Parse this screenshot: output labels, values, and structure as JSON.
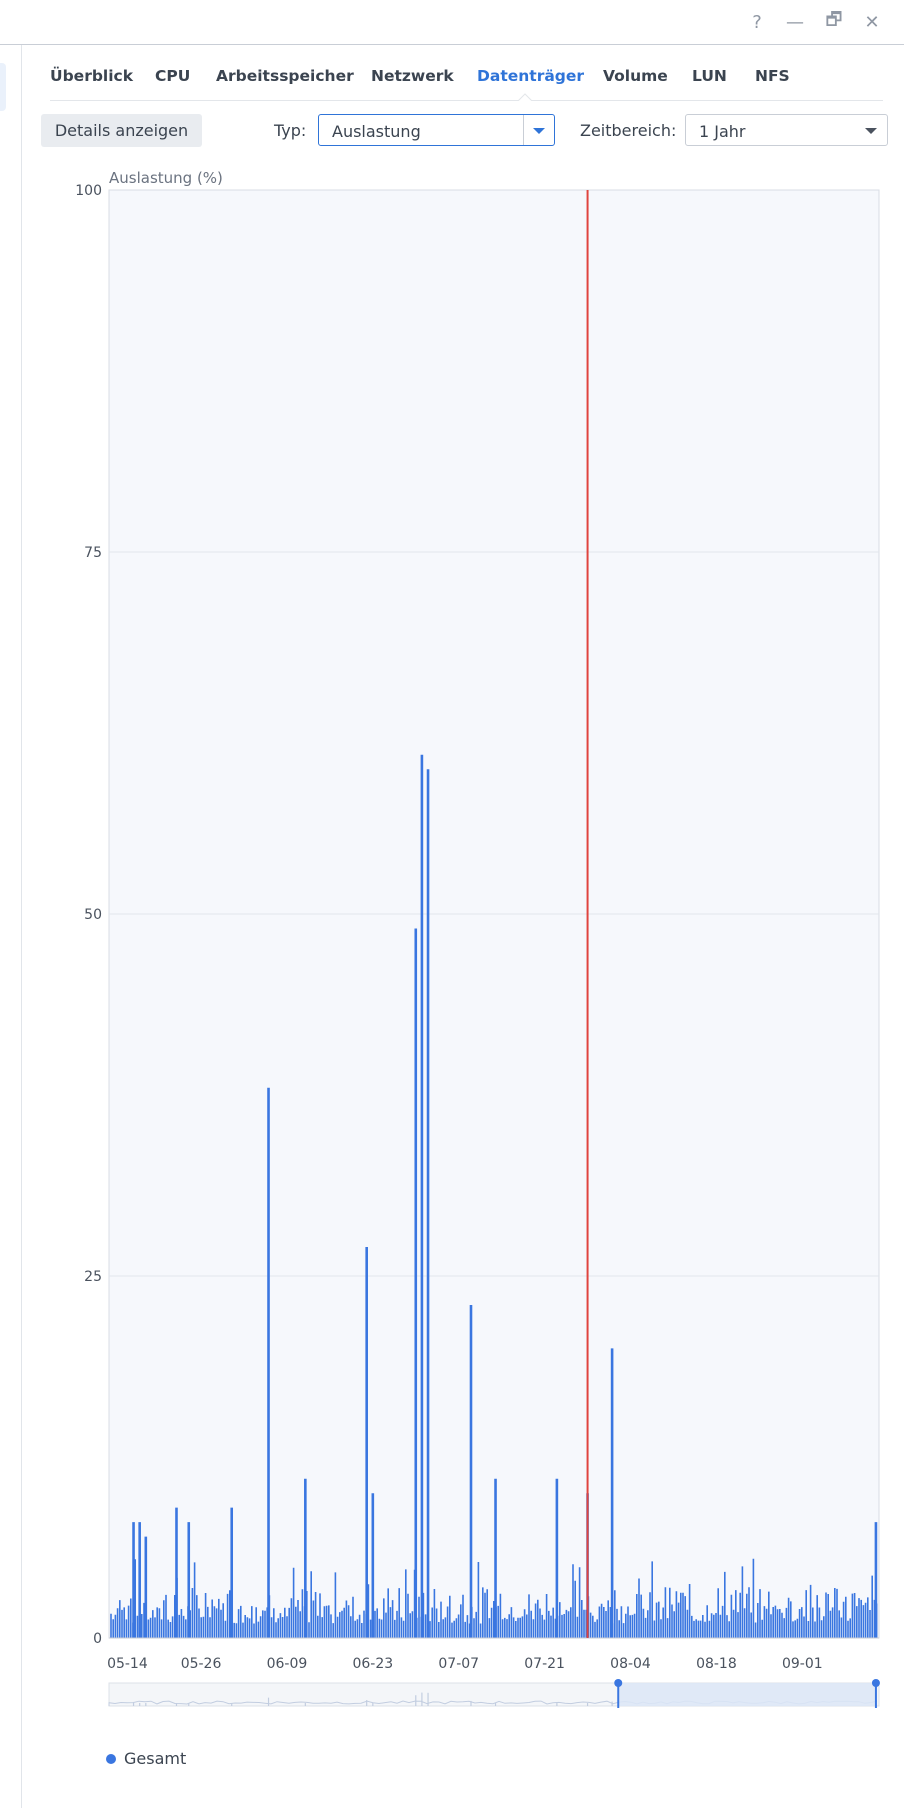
{
  "window": {
    "help_label": "?",
    "minimize_label": "—",
    "restore_label": "🗗",
    "close_label": "✕"
  },
  "tabs": [
    {
      "label": "Überblick"
    },
    {
      "label": "CPU"
    },
    {
      "label": "Arbeitsspeicher"
    },
    {
      "label": "Netzwerk"
    },
    {
      "label": "Datenträger",
      "active": true
    },
    {
      "label": "Volume"
    },
    {
      "label": "LUN"
    },
    {
      "label": "NFS"
    }
  ],
  "toolbar": {
    "details_label": "Details anzeigen",
    "type_label": "Typ:",
    "type_value": "Auslastung",
    "range_label": "Zeitbereich:",
    "range_value": "1 Jahr"
  },
  "colors": {
    "accent": "#2f74d8",
    "series": "#3a76e0",
    "cursor": "#e0443e",
    "plot_bg": "#f6f8fc"
  },
  "chart_data": {
    "type": "bar",
    "ylabel": "Auslastung (%)",
    "ylim": [
      0,
      100
    ],
    "yticks": [
      0,
      25,
      50,
      75,
      100
    ],
    "xticks": [
      "05-14",
      "05-26",
      "06-09",
      "06-23",
      "07-07",
      "07-21",
      "08-04",
      "08-18",
      "09-01"
    ],
    "grid": true,
    "legend": "bottom-left",
    "cursor_at": "07-28",
    "spikes": [
      {
        "x": "05-15",
        "y": 8
      },
      {
        "x": "05-16",
        "y": 8
      },
      {
        "x": "05-17",
        "y": 7
      },
      {
        "x": "05-22",
        "y": 9
      },
      {
        "x": "05-24",
        "y": 8
      },
      {
        "x": "05-31",
        "y": 9
      },
      {
        "x": "06-06",
        "y": 38
      },
      {
        "x": "06-12",
        "y": 11
      },
      {
        "x": "06-22",
        "y": 27
      },
      {
        "x": "06-23",
        "y": 10
      },
      {
        "x": "06-30",
        "y": 49
      },
      {
        "x": "07-01",
        "y": 61
      },
      {
        "x": "07-02",
        "y": 60
      },
      {
        "x": "07-09",
        "y": 23
      },
      {
        "x": "07-13",
        "y": 11
      },
      {
        "x": "07-23",
        "y": 11
      },
      {
        "x": "07-28",
        "y": 10
      },
      {
        "x": "08-01",
        "y": 20
      },
      {
        "x": "09-13",
        "y": 8
      }
    ],
    "series": [
      {
        "name": "Gesamt"
      }
    ],
    "navigator": {
      "selection_start": "08-02",
      "selection_end": "09-13"
    }
  }
}
